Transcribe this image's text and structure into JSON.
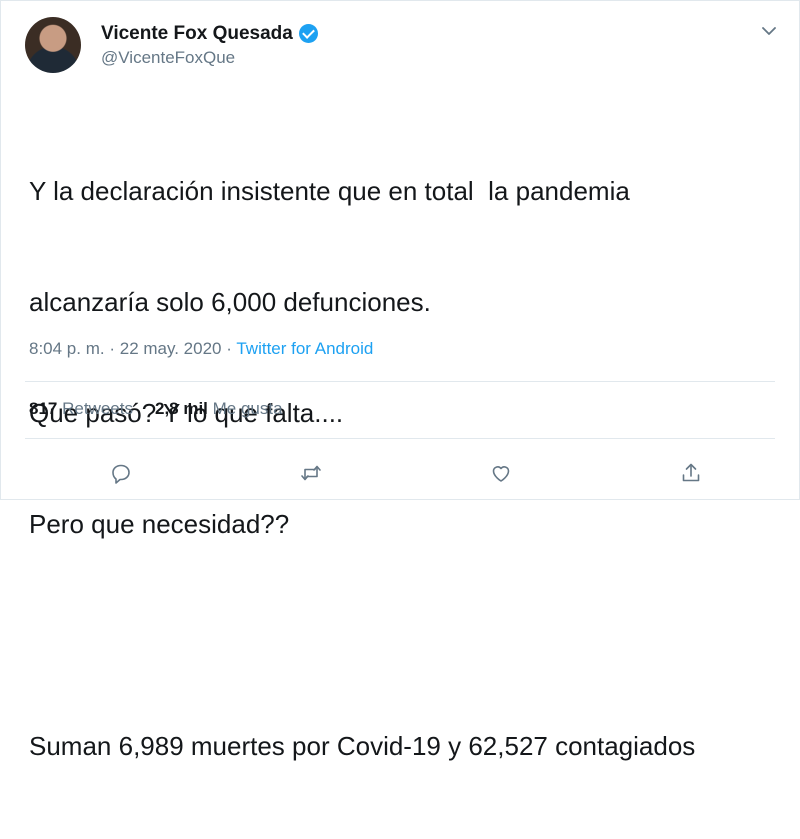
{
  "author": {
    "display_name": "Vicente Fox Quesada",
    "handle": "@VicenteFoxQue",
    "verified": true
  },
  "tweet": {
    "lines": [
      "Y la declaración insistente que en total  la pandemia",
      "alcanzaría solo 6,000 defunciones.",
      "Que pasó? Y lo que falta....",
      "Pero que necesidad??",
      "",
      "Suman 6,989 muertes por Covid-19 y 62,527 contagiados"
    ],
    "time": "8:04 p. m.",
    "separator": "·",
    "date": "22 may. 2020",
    "source": "Twitter for Android"
  },
  "stats": {
    "retweets_count": "817",
    "retweets_label": "Retweets",
    "likes_count": "2,8 mil",
    "likes_label": "Me gusta"
  },
  "icons": {
    "reply": "reply-icon",
    "retweet": "retweet-icon",
    "like": "heart-icon",
    "share": "share-icon",
    "menu": "chevron-down-icon"
  },
  "colors": {
    "accent": "#1da1f2",
    "secondary_text": "#657786",
    "primary_text": "#14171a"
  }
}
